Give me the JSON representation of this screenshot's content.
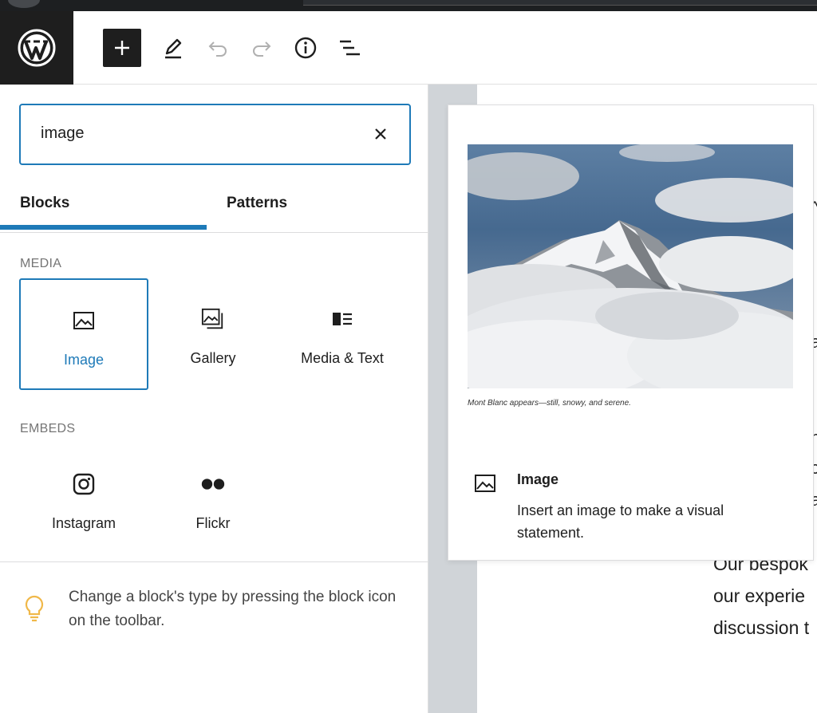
{
  "header": {
    "logo": "wordpress-logo",
    "tools": [
      "add-block-icon",
      "edit-pencil-icon",
      "undo-icon",
      "redo-icon",
      "info-icon",
      "list-view-icon"
    ]
  },
  "inserter": {
    "search": {
      "value": "image",
      "clear_icon": "close-icon"
    },
    "tabs": [
      {
        "label": "Blocks",
        "active": true
      },
      {
        "label": "Patterns",
        "active": false
      }
    ],
    "categories": [
      {
        "name": "MEDIA",
        "items": [
          {
            "label": "Image",
            "icon": "image-icon",
            "selected": true
          },
          {
            "label": "Gallery",
            "icon": "gallery-icon",
            "selected": false
          },
          {
            "label": "Media & Text",
            "icon": "media-text-icon",
            "selected": false
          }
        ]
      },
      {
        "name": "EMBEDS",
        "items": [
          {
            "label": "Instagram",
            "icon": "instagram-icon",
            "selected": false
          },
          {
            "label": "Flickr",
            "icon": "flickr-icon",
            "selected": false
          }
        ]
      }
    ],
    "tip": "Change a block's type by pressing the block icon on the toolbar."
  },
  "preview": {
    "caption": "Mont Blanc appears—still, snowy, and serene.",
    "block_title": "Image",
    "block_description": "Insert an image to make a visual statement."
  },
  "document": {
    "lines": [
      "Our bespok",
      "our experie",
      "discussion t"
    ]
  },
  "colors": {
    "accent": "#1e7ab8",
    "dark": "#1e1e1e",
    "canvas": "#d0d4d8",
    "tip_bulb": "#f0b849"
  }
}
